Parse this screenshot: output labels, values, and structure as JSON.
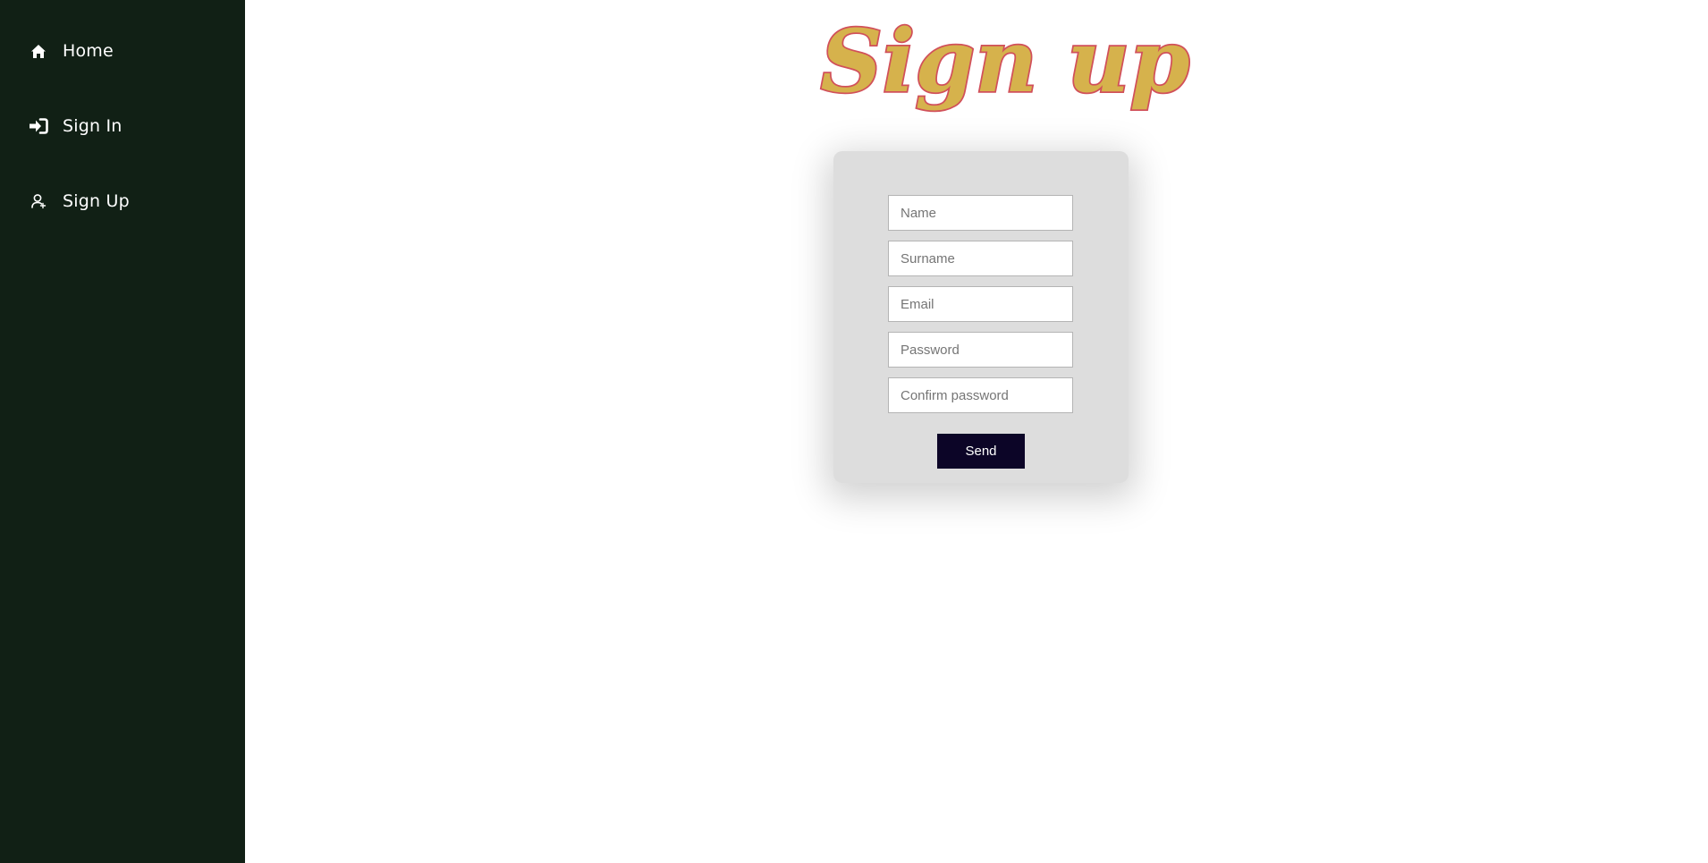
{
  "sidebar": {
    "background": "#112015",
    "items": [
      {
        "label": "Home",
        "icon": "home-icon"
      },
      {
        "label": "Sign In",
        "icon": "sign-in-icon"
      },
      {
        "label": "Sign Up",
        "icon": "user-add-icon"
      }
    ]
  },
  "main": {
    "title": "Sign up",
    "title_colors": {
      "fill": "#d6b24c",
      "stroke": "#d1505a"
    },
    "form": {
      "fields": [
        {
          "placeholder": "Name",
          "value": ""
        },
        {
          "placeholder": "Surname",
          "value": ""
        },
        {
          "placeholder": "Email",
          "value": ""
        },
        {
          "placeholder": "Password",
          "value": ""
        },
        {
          "placeholder": "Confirm password",
          "value": ""
        }
      ],
      "submit_label": "Send",
      "submit_color": "#0c0527",
      "card_color": "#dddddd"
    }
  }
}
